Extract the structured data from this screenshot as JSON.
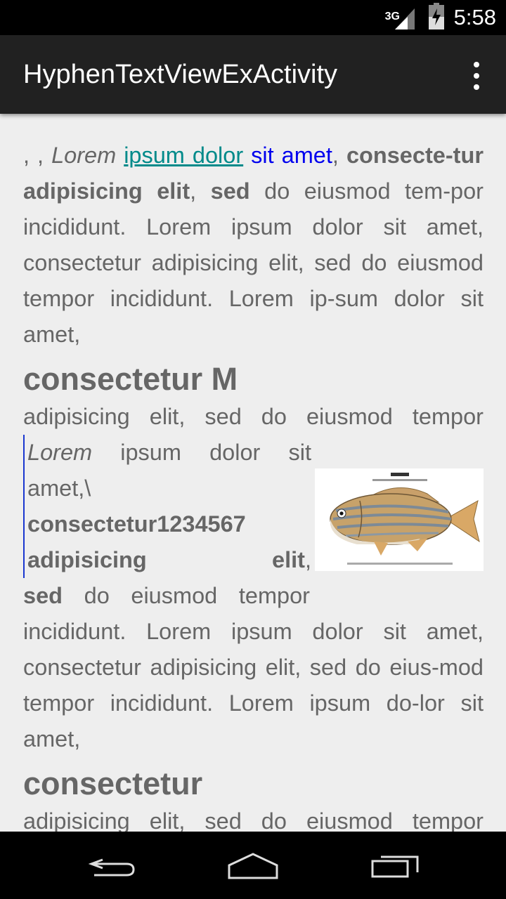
{
  "status_bar": {
    "network": "3G",
    "time": "5:58",
    "icons": [
      "signal-icon",
      "battery-charging-icon"
    ]
  },
  "action_bar": {
    "title": "HyphenTextViewExActivity",
    "overflow_icon": "overflow-menu-icon"
  },
  "content": {
    "p1": {
      "lead": ", , ",
      "italic": "Lorem",
      "link": "ipsum dolor",
      "blue": "sit amet",
      "comma1": ", ",
      "bold1": "consecte-tur adipisicing elit",
      "comma2": ", ",
      "bold2": "sed",
      "rest": " do eiusmod tem-por incididunt. Lorem ipsum dolor sit amet, consectetur adipisicing elit, sed do eiusmod tempor incididunt. Lorem ip-sum dolor sit amet,"
    },
    "heading1": "consectetur M",
    "line1": "adipisicing elit, sed do eiusmod tempor",
    "quote": {
      "italic": "Lorem",
      "text1": " ipsum dolor sit amet,\\ ",
      "bold": "consectetur1234567 adipisicing elit",
      "text2": ","
    },
    "after_quote": {
      "bold": "sed",
      "text": " do eiusmod tempor"
    },
    "p2": "incididunt. Lorem ipsum dolor sit amet, consectetur adipisicing elit, sed do eius-mod tempor incididunt. Lorem ipsum do-lor sit amet,",
    "heading2": "consectetur",
    "line2": "adipisicing elit, sed do eiusmod tempor",
    "image_icon": "fish-illustration"
  },
  "nav_bar": {
    "icons": [
      "back-icon",
      "home-icon",
      "recents-icon"
    ]
  }
}
